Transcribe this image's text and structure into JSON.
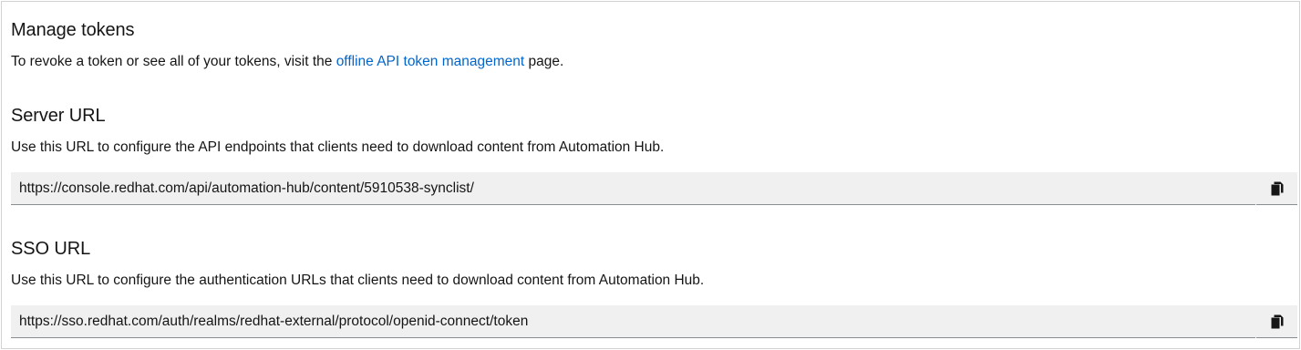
{
  "manage_tokens": {
    "title": "Manage tokens",
    "text_before": "To revoke a token or see all of your tokens, visit the ",
    "link_label": "offline API token management",
    "text_after": " page."
  },
  "server_url": {
    "title": "Server URL",
    "description": "Use this URL to configure the API endpoints that clients need to download content from Automation Hub.",
    "value": "https://console.redhat.com/api/automation-hub/content/5910538-synclist/",
    "copy_icon": "copy-icon"
  },
  "sso_url": {
    "title": "SSO URL",
    "description": "Use this URL to configure the authentication URLs that clients need to download content from Automation Hub.",
    "value": "https://sso.redhat.com/auth/realms/redhat-external/protocol/openid-connect/token",
    "copy_icon": "copy-icon"
  }
}
